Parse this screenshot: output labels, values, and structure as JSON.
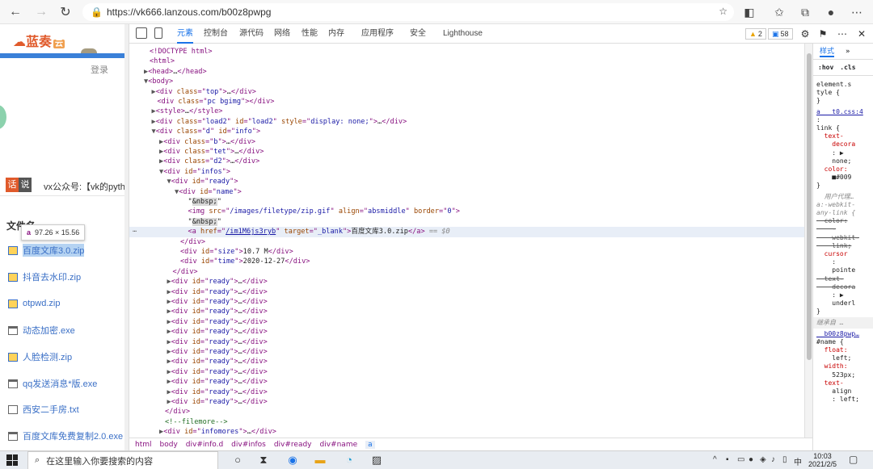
{
  "browser": {
    "url": "https://vk666.lanzous.com/b00z8pwpg",
    "back_icon": "arrow-left-icon",
    "forward_icon": "arrow-right-icon",
    "refresh_icon": "refresh-icon",
    "lock_icon": "lock-icon"
  },
  "page": {
    "logo_text": "蓝奏",
    "logo_badge": "云",
    "login_label": "登录",
    "talk_badge_1": "话",
    "talk_badge_2": "说",
    "wx_text": "vx公众号:【vk的pytho",
    "files_heading": "文件名",
    "tooltip_tag": "a",
    "tooltip_size": "97.26 × 15.56",
    "files": [
      {
        "name": "百度文库3.0.zip",
        "type": "zip"
      },
      {
        "name": "抖音去水印.zip",
        "type": "zip"
      },
      {
        "name": "otpwd.zip",
        "type": "zip"
      },
      {
        "name": "动态加密.exe",
        "type": "exe"
      },
      {
        "name": "人脸检测.zip",
        "type": "zip"
      },
      {
        "name": "qq发送消息*版.exe",
        "type": "exe"
      },
      {
        "name": "西安二手房.txt",
        "type": "txt"
      },
      {
        "name": "百度文库免费复制2.0.exe",
        "type": "exe"
      }
    ]
  },
  "devtools": {
    "tabs": [
      "元素",
      "控制台",
      "源代码",
      "网络",
      "性能",
      "内存",
      "应用程序",
      "安全",
      "Lighthouse"
    ],
    "active_tab": "元素",
    "warnings_count": "2",
    "messages_count": "58",
    "dom_lines": [
      {
        "indent": 0,
        "arrow": "",
        "html": "<span class='tag'>&lt;!DOCTYPE html&gt;</span>"
      },
      {
        "indent": 0,
        "arrow": "",
        "html": "<span class='tag'>&lt;html&gt;</span>"
      },
      {
        "indent": 0,
        "arrow": "▶",
        "html": "<span class='tag'>&lt;head&gt;</span><span class='tx'>…</span><span class='tag'>&lt;/head&gt;</span>"
      },
      {
        "indent": 0,
        "arrow": "▼",
        "html": "<span class='tag'>&lt;body&gt;</span>"
      },
      {
        "indent": 1,
        "arrow": "▶",
        "html": "<span class='tag'>&lt;div </span><span class='an'>class</span><span class='tag'>=\"</span><span class='av'>top</span><span class='tag'>\"&gt;</span><span class='tx'>…</span><span class='tag'>&lt;/div&gt;</span>"
      },
      {
        "indent": 1,
        "arrow": "",
        "html": "<span class='tag'>&lt;div </span><span class='an'>class</span><span class='tag'>=\"</span><span class='av'>pc bgimg</span><span class='tag'>\"&gt;&lt;/div&gt;</span>"
      },
      {
        "indent": 1,
        "arrow": "▶",
        "html": "<span class='tag'>&lt;style&gt;</span><span class='tx'>…</span><span class='tag'>&lt;/style&gt;</span>"
      },
      {
        "indent": 1,
        "arrow": "▶",
        "html": "<span class='tag'>&lt;div </span><span class='an'>class</span><span class='tag'>=\"</span><span class='av'>load2</span><span class='tag'>\" </span><span class='an'>id</span><span class='tag'>=\"</span><span class='av'>load2</span><span class='tag'>\" </span><span class='an'>style</span><span class='tag'>=\"</span><span class='av'>display: none;</span><span class='tag'>\"&gt;</span><span class='tx'>…</span><span class='tag'>&lt;/div&gt;</span>"
      },
      {
        "indent": 1,
        "arrow": "▼",
        "html": "<span class='tag'>&lt;div </span><span class='an'>class</span><span class='tag'>=\"</span><span class='av'>d</span><span class='tag'>\" </span><span class='an'>id</span><span class='tag'>=\"</span><span class='av'>info</span><span class='tag'>\"&gt;</span>"
      },
      {
        "indent": 2,
        "arrow": "▶",
        "html": "<span class='tag'>&lt;div </span><span class='an'>class</span><span class='tag'>=\"</span><span class='av'>b</span><span class='tag'>\"&gt;</span><span class='tx'>…</span><span class='tag'>&lt;/div&gt;</span>"
      },
      {
        "indent": 2,
        "arrow": "▶",
        "html": "<span class='tag'>&lt;div </span><span class='an'>class</span><span class='tag'>=\"</span><span class='av'>tet</span><span class='tag'>\"&gt;</span><span class='tx'>…</span><span class='tag'>&lt;/div&gt;</span>"
      },
      {
        "indent": 2,
        "arrow": "▶",
        "html": "<span class='tag'>&lt;div </span><span class='an'>class</span><span class='tag'>=\"</span><span class='av'>d2</span><span class='tag'>\"&gt;</span><span class='tx'>…</span><span class='tag'>&lt;/div&gt;</span>"
      },
      {
        "indent": 2,
        "arrow": "▼",
        "html": "<span class='tag'>&lt;div </span><span class='an'>id</span><span class='tag'>=\"</span><span class='av'>infos</span><span class='tag'>\"&gt;</span>"
      },
      {
        "indent": 3,
        "arrow": "▼",
        "html": "<span class='tag'>&lt;div </span><span class='an'>id</span><span class='tag'>=\"</span><span class='av'>ready</span><span class='tag'>\"&gt;</span>"
      },
      {
        "indent": 4,
        "arrow": "▼",
        "html": "<span class='tag'>&lt;div </span><span class='an'>id</span><span class='tag'>=\"</span><span class='av'>name</span><span class='tag'>\"&gt;</span>"
      },
      {
        "indent": 5,
        "arrow": "",
        "html": "<span class='tx'>\"<span class='nbsp-hl'>&amp;nbsp;</span>\"</span>"
      },
      {
        "indent": 5,
        "arrow": "",
        "html": "<span class='tag'>&lt;img </span><span class='an'>src</span><span class='tag'>=\"</span><span class='av'>/images/filetype/zip.gif</span><span class='tag'>\" </span><span class='an'>align</span><span class='tag'>=\"</span><span class='av'>absmiddle</span><span class='tag'>\" </span><span class='an'>border</span><span class='tag'>=\"</span><span class='av'>0</span><span class='tag'>\"&gt;</span>"
      },
      {
        "indent": 5,
        "arrow": "",
        "html": "<span class='tx'>\"<span class='nbsp-hl'>&amp;nbsp;</span>\"</span>"
      },
      {
        "indent": 5,
        "arrow": "",
        "selected": true,
        "html": "<span class='tag'>&lt;a </span><span class='an'>href</span><span class='tag'>=\"</span><span class='av' style='text-decoration:underline'>/im1M6js3ryb</span><span class='tag'>\" </span><span class='an'>target</span><span class='tag'>=\"</span><span class='av'>_blank</span><span class='tag'>\"&gt;</span><span class='tx'>百度文库3.0.zip</span><span class='tag'>&lt;/a&gt;</span> <span class='eq'>== $0</span>"
      },
      {
        "indent": 4,
        "arrow": "",
        "html": "<span class='tag'>&lt;/div&gt;</span>"
      },
      {
        "indent": 4,
        "arrow": "",
        "html": "<span class='tag'>&lt;div </span><span class='an'>id</span><span class='tag'>=\"</span><span class='av'>size</span><span class='tag'>\"&gt;</span><span class='tx'>10.7 M</span><span class='tag'>&lt;/div&gt;</span>"
      },
      {
        "indent": 4,
        "arrow": "",
        "html": "<span class='tag'>&lt;div </span><span class='an'>id</span><span class='tag'>=\"</span><span class='av'>time</span><span class='tag'>\"&gt;</span><span class='tx'>2020-12-27</span><span class='tag'>&lt;/div&gt;</span>"
      },
      {
        "indent": 3,
        "arrow": "",
        "html": "<span class='tag'>&lt;/div&gt;</span>"
      },
      {
        "indent": 3,
        "arrow": "▶",
        "html": "<span class='tag'>&lt;div </span><span class='an'>id</span><span class='tag'>=\"</span><span class='av'>ready</span><span class='tag'>\"&gt;</span><span class='tx'>…</span><span class='tag'>&lt;/div&gt;</span>"
      },
      {
        "indent": 3,
        "arrow": "▶",
        "html": "<span class='tag'>&lt;div </span><span class='an'>id</span><span class='tag'>=\"</span><span class='av'>ready</span><span class='tag'>\"&gt;</span><span class='tx'>…</span><span class='tag'>&lt;/div&gt;</span>"
      },
      {
        "indent": 3,
        "arrow": "▶",
        "html": "<span class='tag'>&lt;div </span><span class='an'>id</span><span class='tag'>=\"</span><span class='av'>ready</span><span class='tag'>\"&gt;</span><span class='tx'>…</span><span class='tag'>&lt;/div&gt;</span>"
      },
      {
        "indent": 3,
        "arrow": "▶",
        "html": "<span class='tag'>&lt;div </span><span class='an'>id</span><span class='tag'>=\"</span><span class='av'>ready</span><span class='tag'>\"&gt;</span><span class='tx'>…</span><span class='tag'>&lt;/div&gt;</span>"
      },
      {
        "indent": 3,
        "arrow": "▶",
        "html": "<span class='tag'>&lt;div </span><span class='an'>id</span><span class='tag'>=\"</span><span class='av'>ready</span><span class='tag'>\"&gt;</span><span class='tx'>…</span><span class='tag'>&lt;/div&gt;</span>"
      },
      {
        "indent": 3,
        "arrow": "▶",
        "html": "<span class='tag'>&lt;div </span><span class='an'>id</span><span class='tag'>=\"</span><span class='av'>ready</span><span class='tag'>\"&gt;</span><span class='tx'>…</span><span class='tag'>&lt;/div&gt;</span>"
      },
      {
        "indent": 3,
        "arrow": "▶",
        "html": "<span class='tag'>&lt;div </span><span class='an'>id</span><span class='tag'>=\"</span><span class='av'>ready</span><span class='tag'>\"&gt;</span><span class='tx'>…</span><span class='tag'>&lt;/div&gt;</span>"
      },
      {
        "indent": 3,
        "arrow": "▶",
        "html": "<span class='tag'>&lt;div </span><span class='an'>id</span><span class='tag'>=\"</span><span class='av'>ready</span><span class='tag'>\"&gt;</span><span class='tx'>…</span><span class='tag'>&lt;/div&gt;</span>"
      },
      {
        "indent": 3,
        "arrow": "▶",
        "html": "<span class='tag'>&lt;div </span><span class='an'>id</span><span class='tag'>=\"</span><span class='av'>ready</span><span class='tag'>\"&gt;</span><span class='tx'>…</span><span class='tag'>&lt;/div&gt;</span>"
      },
      {
        "indent": 3,
        "arrow": "▶",
        "html": "<span class='tag'>&lt;div </span><span class='an'>id</span><span class='tag'>=\"</span><span class='av'>ready</span><span class='tag'>\"&gt;</span><span class='tx'>…</span><span class='tag'>&lt;/div&gt;</span>"
      },
      {
        "indent": 3,
        "arrow": "▶",
        "html": "<span class='tag'>&lt;div </span><span class='an'>id</span><span class='tag'>=\"</span><span class='av'>ready</span><span class='tag'>\"&gt;</span><span class='tx'>…</span><span class='tag'>&lt;/div&gt;</span>"
      },
      {
        "indent": 3,
        "arrow": "▶",
        "html": "<span class='tag'>&lt;div </span><span class='an'>id</span><span class='tag'>=\"</span><span class='av'>ready</span><span class='tag'>\"&gt;</span><span class='tx'>…</span><span class='tag'>&lt;/div&gt;</span>"
      },
      {
        "indent": 3,
        "arrow": "▶",
        "html": "<span class='tag'>&lt;div </span><span class='an'>id</span><span class='tag'>=\"</span><span class='av'>ready</span><span class='tag'>\"&gt;</span><span class='tx'>…</span><span class='tag'>&lt;/div&gt;</span>"
      },
      {
        "indent": 2,
        "arrow": "",
        "html": "<span class='tag'>&lt;/div&gt;</span>"
      },
      {
        "indent": 2,
        "arrow": "",
        "html": "<span class='cm'>&lt;!--filemore--&gt;</span>"
      },
      {
        "indent": 2,
        "arrow": "▶",
        "html": "<span class='tag'>&lt;div </span><span class='an'>id</span><span class='tag'>=\"</span><span class='av'>infomores</span><span class='tag'>\"&gt;</span><span class='tx'>…</span><span class='tag'>&lt;/div&gt;</span>"
      }
    ],
    "breadcrumb": [
      "html",
      "body",
      "div#info.d",
      "div#infos",
      "div#ready",
      "div#name",
      "a"
    ],
    "styles_tab": "样式",
    "filter_hov": ":hov",
    "filter_cls": ".cls",
    "styles_lines": [
      {
        "kind": "plain",
        "text": "element.s"
      },
      {
        "kind": "plain",
        "text": "tyle {"
      },
      {
        "kind": "plain",
        "text": "}"
      },
      {
        "kind": "link",
        "text": "a   t0.css:4"
      },
      {
        "kind": "plain",
        "text": ":"
      },
      {
        "kind": "plain",
        "text": "link {"
      },
      {
        "kind": "prop",
        "text": "  text-"
      },
      {
        "kind": "prop",
        "text": "    decora"
      },
      {
        "kind": "plain",
        "text": "    : ▶"
      },
      {
        "kind": "plain",
        "text": "    none;"
      },
      {
        "kind": "prop",
        "text": "  color:"
      },
      {
        "kind": "plain",
        "text": "    ■#009"
      },
      {
        "kind": "plain",
        "text": "}"
      },
      {
        "kind": "grey",
        "text": "  用户代理…"
      },
      {
        "kind": "grey",
        "text": "a:-webkit-"
      },
      {
        "kind": "grey",
        "text": "any-link {"
      },
      {
        "kind": "strike",
        "text": "  color:"
      },
      {
        "kind": "strike",
        "text": "    -"
      },
      {
        "kind": "strike",
        "text": "    webkit-"
      },
      {
        "kind": "strike",
        "text": "    link;"
      },
      {
        "kind": "prop",
        "text": "  cursor"
      },
      {
        "kind": "plain",
        "text": "    :"
      },
      {
        "kind": "plain",
        "text": "    pointe"
      },
      {
        "kind": "strike",
        "text": "  text-"
      },
      {
        "kind": "strike",
        "text": "    decora"
      },
      {
        "kind": "plain",
        "text": "    : ▶"
      },
      {
        "kind": "plain",
        "text": "    underl"
      },
      {
        "kind": "plain",
        "text": "}"
      },
      {
        "kind": "section",
        "text": "继承自 …"
      },
      {
        "kind": "link",
        "text": "  b00z8pwp…"
      },
      {
        "kind": "plain",
        "text": "#name {"
      },
      {
        "kind": "prop",
        "text": "  float:"
      },
      {
        "kind": "plain",
        "text": "    left;"
      },
      {
        "kind": "prop",
        "text": "  width:"
      },
      {
        "kind": "plain",
        "text": "    523px;"
      },
      {
        "kind": "prop",
        "text": "  text-"
      },
      {
        "kind": "plain",
        "text": "    align"
      },
      {
        "kind": "plain",
        "text": "    : left;"
      }
    ]
  },
  "taskbar": {
    "search_placeholder": "在这里输入你要搜索的内容",
    "time": "10:03",
    "date": "2021/2/5",
    "ime": "中"
  },
  "colors": {
    "accent": "#1a73e8",
    "tag": "#881280",
    "attr_name": "#994500",
    "attr_value": "#1a1aa6",
    "link": "#3a6fc6"
  }
}
